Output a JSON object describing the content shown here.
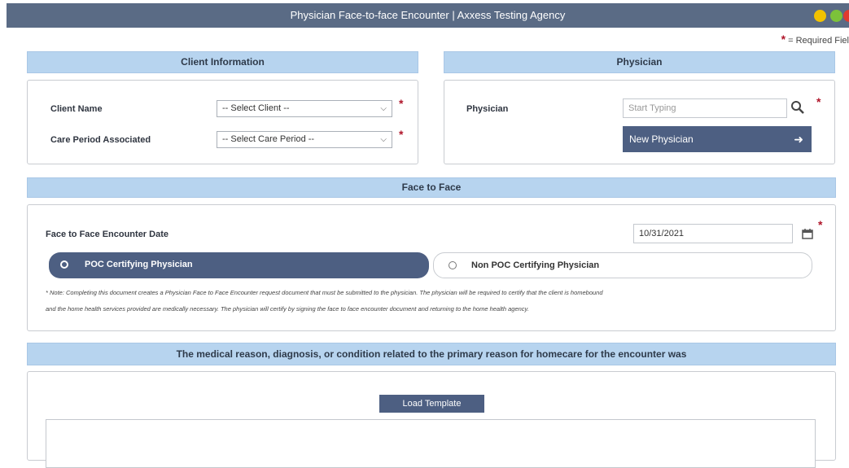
{
  "window": {
    "title": "Physician Face-to-face Encounter | Axxess Testing Agency",
    "colors": {
      "titlebar": "#5a6b85",
      "minimize": "#f2c200",
      "maximize": "#7cc23a",
      "close": "#e03a2f"
    }
  },
  "required_note": "= Required Fiel",
  "required_mark": "*",
  "client_info": {
    "header": "Client Information",
    "client_name_label": "Client Name",
    "client_select": "-- Select Client --",
    "care_period_label": "Care Period Associated",
    "care_period_select": "-- Select Care Period --"
  },
  "physician": {
    "header": "Physician",
    "label": "Physician",
    "search_placeholder": "Start Typing",
    "new_button": "New Physician"
  },
  "face_to_face": {
    "header": "Face to Face",
    "date_label": "Face to Face Encounter Date",
    "date_value": "10/31/2021",
    "option_poc": "POC Certifying Physician",
    "option_non_poc": "Non POC Certifying Physician",
    "selected": "POC Certifying Physician",
    "note_line1": "* Note: Completing this document creates a Physician Face to Face Encounter request document that must be submitted to the physician. The physician will be required to certify that the client is homebound",
    "note_line2": "and the home health services provided are medically necessary. The physician will certify by signing the face to face encounter document and returning to the home health agency."
  },
  "medical_reason": {
    "header": "The medical reason, diagnosis, or condition related to the primary reason for homecare for the encounter was",
    "load_template_button": "Load Template",
    "textarea_value": ""
  },
  "icons": {
    "select_chevron": "chevron-down-icon",
    "search": "search-icon",
    "arrow_right": "arrow-right-icon",
    "calendar": "calendar-icon"
  }
}
